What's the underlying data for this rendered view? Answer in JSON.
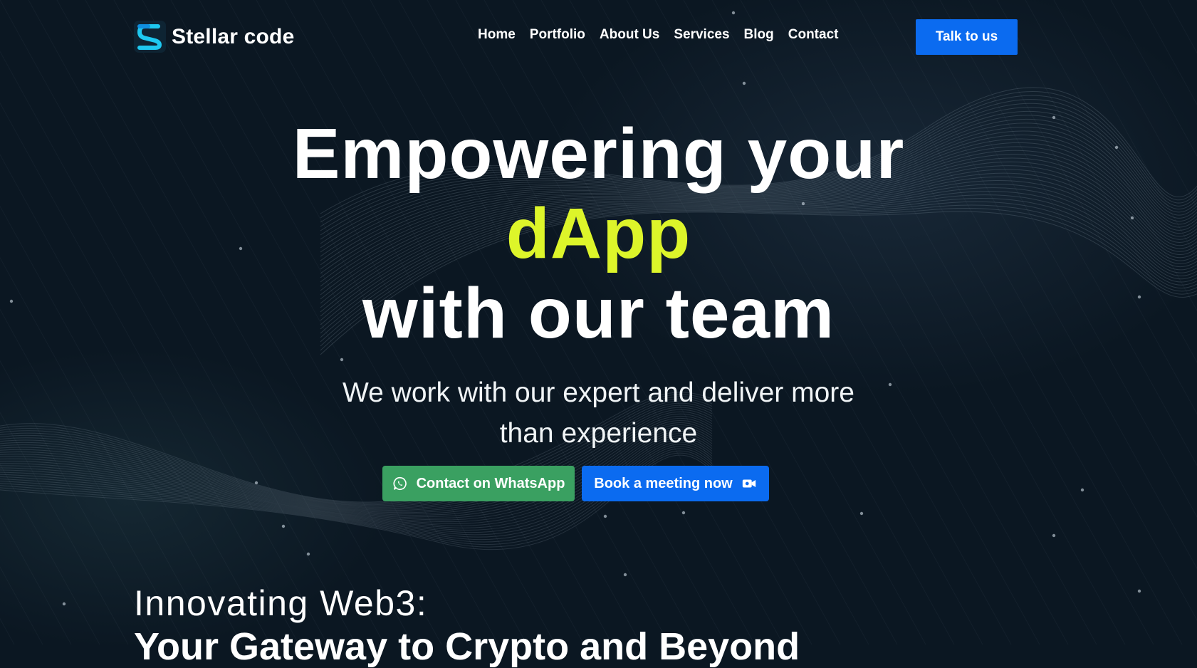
{
  "brand": {
    "name": "Stellar code",
    "logo_icon": "s-logo-icon",
    "accent": "#1ec8f0"
  },
  "nav": {
    "items": [
      {
        "label": "Home"
      },
      {
        "label": "Portfolio"
      },
      {
        "label": "About Us"
      },
      {
        "label": "Services"
      },
      {
        "label": "Blog"
      },
      {
        "label": "Contact"
      }
    ],
    "cta_label": "Talk to us"
  },
  "hero": {
    "line1": "Empowering your",
    "line2": "dApp",
    "line3": "with our team",
    "subtitle_line1": "We work with our expert and deliver more",
    "subtitle_line2": "than experience",
    "accent_color": "#ddf52a"
  },
  "buttons": {
    "whatsapp_label": "Contact on WhatsApp",
    "whatsapp_icon": "whatsapp-icon",
    "whatsapp_color": "#3aa061",
    "meeting_label": "Book a meeting now",
    "meeting_icon": "video-camera-icon",
    "meeting_color": "#0b6bf0"
  },
  "section": {
    "title": "Innovating Web3:",
    "subtitle": "Your Gateway to Crypto and Beyond"
  }
}
